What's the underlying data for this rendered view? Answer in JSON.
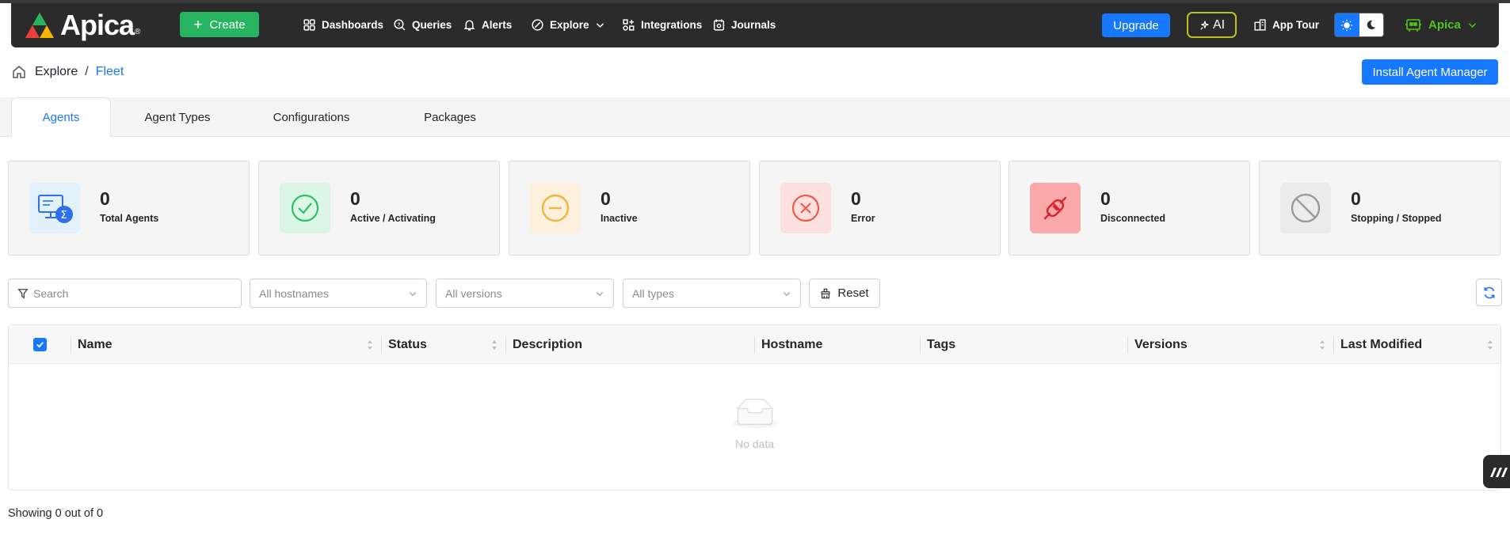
{
  "app": {
    "brand": "Apica",
    "brand_mark": "®",
    "create_label": "Create",
    "nav": [
      {
        "label": "Dashboards",
        "icon": "grid-icon"
      },
      {
        "label": "Queries",
        "icon": "query-icon"
      },
      {
        "label": "Alerts",
        "icon": "bell-icon"
      },
      {
        "label": "Explore",
        "icon": "compass-icon"
      },
      {
        "label": "Integrations",
        "icon": "integrations-icon"
      },
      {
        "label": "Journals",
        "icon": "journal-icon"
      }
    ],
    "upgrade_label": "Upgrade",
    "ai_label": "AI",
    "app_tour_label": "App Tour",
    "user_label": "Apica"
  },
  "breadcrumb": {
    "parent": "Explore",
    "separator": "/",
    "current": "Fleet"
  },
  "install_label": "Install Agent Manager",
  "tabs": [
    {
      "label": "Agents",
      "active": true
    },
    {
      "label": "Agent Types",
      "active": false
    },
    {
      "label": "Configurations",
      "active": false
    },
    {
      "label": "Packages",
      "active": false
    }
  ],
  "stats": [
    {
      "value": "0",
      "label": "Total Agents",
      "icon": "monitor-sigma-icon",
      "color": "#2f6fed",
      "bg": "#e3f1fb"
    },
    {
      "value": "0",
      "label": "Active / Activating",
      "icon": "check-circle-icon",
      "color": "#2dbf6b",
      "bg": "#dcf6e6"
    },
    {
      "value": "0",
      "label": "Inactive",
      "icon": "minus-circle-icon",
      "color": "#f3b63b",
      "bg": "#fdf0dc"
    },
    {
      "value": "0",
      "label": "Error",
      "icon": "x-circle-icon",
      "color": "#ee5a4a",
      "bg": "#fde0e0"
    },
    {
      "value": "0",
      "label": "Disconnected",
      "icon": "unplugged-icon",
      "color": "#d9262e",
      "bg": "#f9a9a9"
    },
    {
      "value": "0",
      "label": "Stopping / Stopped",
      "icon": "ban-icon",
      "color": "#9a9a9a",
      "bg": "#ececec"
    }
  ],
  "filters": {
    "search_placeholder": "Search",
    "hostnames": "All hostnames",
    "versions": "All versions",
    "types": "All types",
    "reset_label": "Reset"
  },
  "table": {
    "columns": [
      "Name",
      "Status",
      "Description",
      "Hostname",
      "Tags",
      "Versions",
      "Last Modified"
    ],
    "empty_text": "No data"
  },
  "footer": {
    "count_text": "Showing 0 out of 0"
  },
  "colors": {
    "primary": "#1677ff",
    "success": "#27b561",
    "navbar": "#2b2b2b"
  }
}
